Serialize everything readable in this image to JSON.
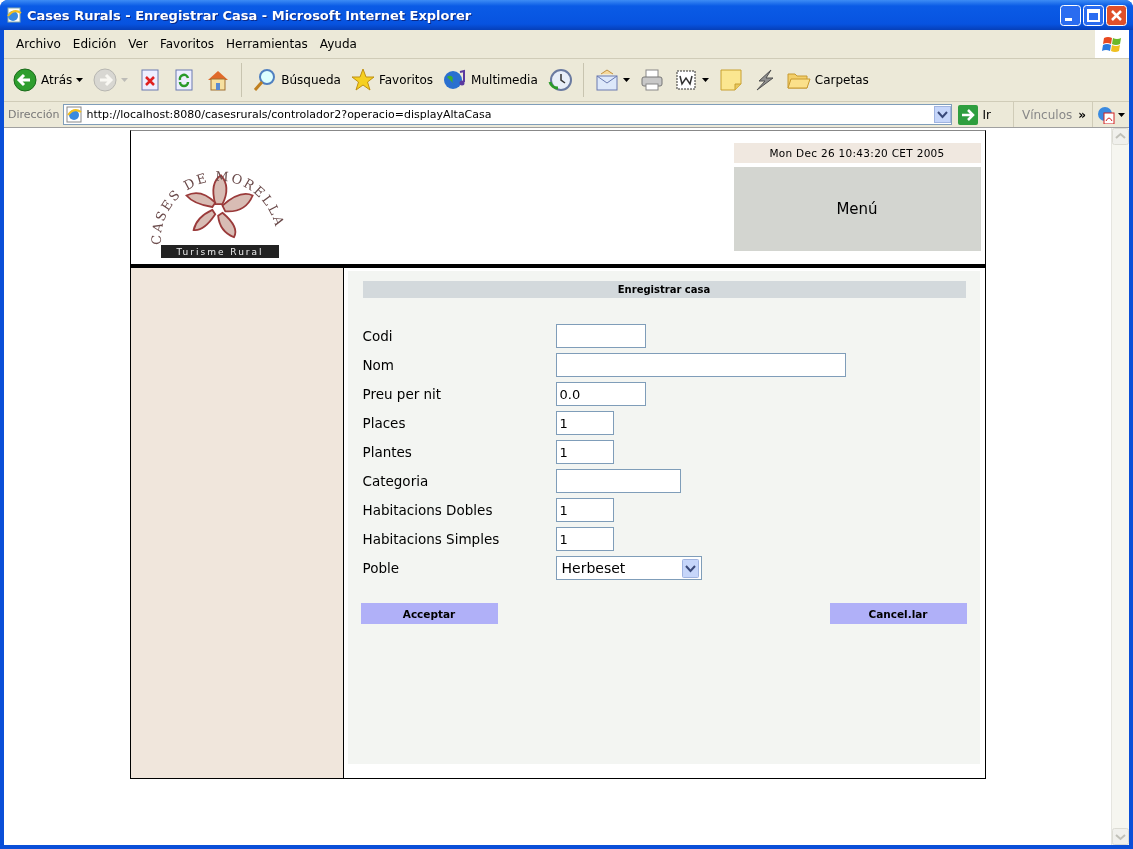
{
  "window": {
    "title": "Cases Rurals - Enregistrar Casa - Microsoft Internet Explorer"
  },
  "menu": [
    "Archivo",
    "Edición",
    "Ver",
    "Favoritos",
    "Herramientas",
    "Ayuda"
  ],
  "toolbar": [
    {
      "label": "Atrás",
      "dropdown": true,
      "disabled": false
    },
    {
      "dropdown": true,
      "disabled": true
    },
    {
      "dropdown": false,
      "disabled": false
    },
    {
      "dropdown": false,
      "disabled": false
    },
    {
      "dropdown": false,
      "disabled": false
    },
    {
      "label": "Búsqueda",
      "dropdown": false,
      "disabled": false
    },
    {
      "label": "Favoritos",
      "dropdown": false,
      "disabled": false
    },
    {
      "label": "Multimedia",
      "dropdown": false,
      "disabled": false
    },
    {
      "dropdown": false,
      "disabled": false
    },
    {
      "dropdown": true,
      "disabled": false
    },
    {
      "dropdown": false,
      "disabled": false
    },
    {
      "dropdown": true,
      "disabled": false
    },
    {
      "dropdown": false,
      "disabled": false
    },
    {
      "dropdown": false,
      "disabled": false
    },
    {
      "label": "Carpetas",
      "dropdown": false,
      "disabled": false
    }
  ],
  "address_bar": {
    "label": "Dirección",
    "url": "http://localhost:8080/casesrurals/controlador2?operacio=displayAltaCasa",
    "go": "Ir",
    "links": "Vínculos",
    "more": "»"
  },
  "page": {
    "logo": {
      "arc_text": "CASES DE MORELLA",
      "tagline": "Turisme Rural"
    },
    "date": "Mon Dec 26 10:43:20 CET 2005",
    "menu": "Menú",
    "form": {
      "title": "Enregistrar casa",
      "fields": [
        {
          "label": "Codi",
          "kind": "short"
        },
        {
          "label": "Nom",
          "kind": "long"
        },
        {
          "label": "Preu per nit",
          "kind": "short",
          "value": "0.0"
        },
        {
          "label": "Places",
          "kind": "tiny",
          "value": "1"
        },
        {
          "label": "Plantes",
          "kind": "tiny",
          "value": "1"
        },
        {
          "label": "Categoria",
          "kind": "medium"
        },
        {
          "label": "Habitacions Dobles",
          "kind": "tiny",
          "value": "1"
        },
        {
          "label": "Habitacions Simples",
          "kind": "tiny",
          "value": "1"
        },
        {
          "label": "Poble",
          "kind": "select",
          "value": "Herbeset"
        }
      ],
      "buttons": [
        "Acceptar",
        "Cancel.lar"
      ]
    }
  }
}
